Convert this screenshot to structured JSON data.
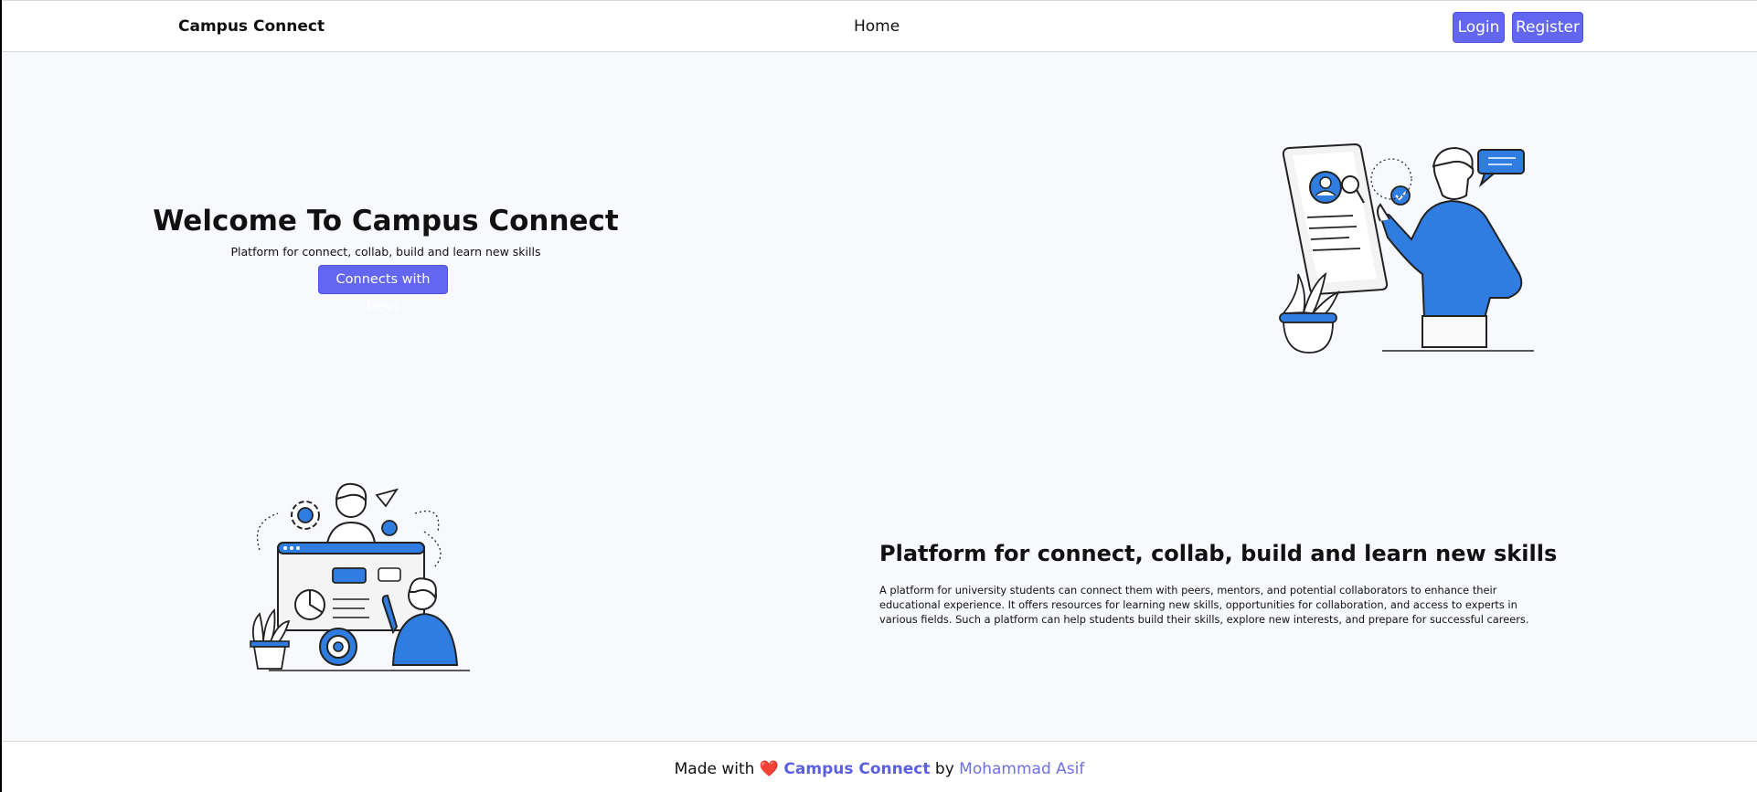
{
  "navbar": {
    "brand": "Campus Connect",
    "home_label": "Home",
    "login_label": "Login",
    "register_label": "Register"
  },
  "hero": {
    "title": "Welcome To Campus Connect",
    "subtitle": "Platform for connect, collab, build and learn new skills",
    "cta_label": "Connects with Devs"
  },
  "about": {
    "title": "Platform for connect, collab, build and learn new skills",
    "body": "A platform for university students can connect them with peers, mentors, and potential collaborators to enhance their educational experience. It offers resources for learning new skills, opportunities for collaboration, and access to experts in various fields. Such a platform can help students build their skills, explore new interests, and prepare for successful careers."
  },
  "footer": {
    "made_with": "Made with",
    "heart": "❤️",
    "brand": "Campus Connect",
    "by": "by",
    "author": "Mohammad Asif"
  },
  "colors": {
    "accent": "#6366f1",
    "illustration_blue": "#2f7de1",
    "background": "#f8f9fc"
  },
  "icons": [
    "resume-illustration",
    "collaboration-illustration",
    "heart-icon"
  ]
}
